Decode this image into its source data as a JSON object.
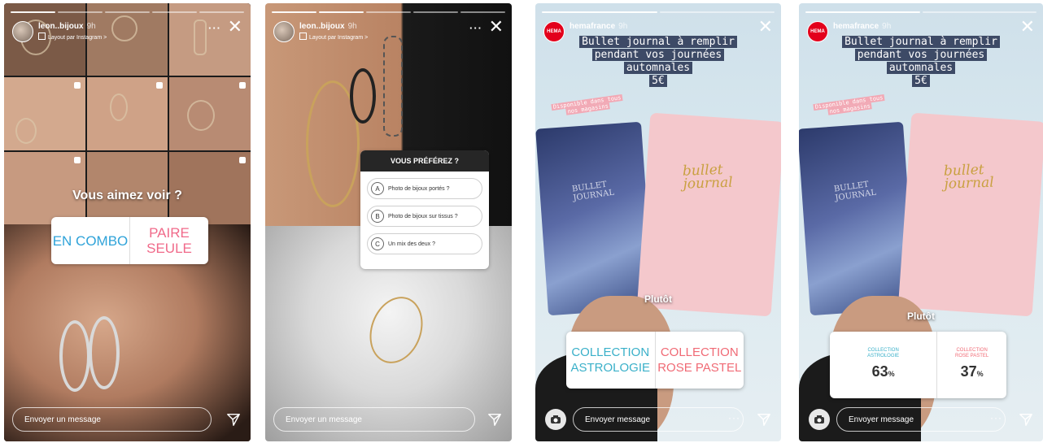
{
  "stories": {
    "leon": {
      "username": "leon..bijoux",
      "time": "9h",
      "subtitle": "Layout par Instagram >",
      "question": "Vous aimez voir ?",
      "poll": {
        "option_a": "EN COMBO",
        "option_b_line1": "PAIRE",
        "option_b_line2": "SEULE"
      },
      "message_placeholder": "Envoyer un message"
    },
    "leon_quiz": {
      "username": "leon..bijoux",
      "time": "9h",
      "subtitle": "Layout par Instagram >",
      "quiz": {
        "title": "VOUS PRÉFÉREZ ?",
        "options": [
          {
            "letter": "A",
            "text": "Photo de bijoux portés ?"
          },
          {
            "letter": "B",
            "text": "Photo de bijoux sur tissus ?"
          },
          {
            "letter": "C",
            "text": "Un mix des deux ?"
          }
        ]
      },
      "message_placeholder": "Envoyer un message"
    },
    "hema_poll": {
      "username": "hemafrance",
      "time": "9h",
      "avatar_text": "HEMA",
      "headline": [
        "Bullet journal à remplir",
        "pendant vos journées",
        "automnales",
        "5€"
      ],
      "sub_sticker": [
        "Disponible dans tous",
        "nos magasins"
      ],
      "book_blue_title": [
        "BULLET",
        "JOURNAL"
      ],
      "book_pink_title": [
        "bullet",
        "journal"
      ],
      "question": "Plutôt",
      "poll": {
        "option_a_line1": "COLLECTION",
        "option_a_line2": "ASTROLOGIE",
        "option_b_line1": "COLLECTION",
        "option_b_line2": "ROSE PASTEL"
      },
      "message_placeholder": "Envoyer message"
    },
    "hema_results": {
      "username": "hemafrance",
      "time": "9h",
      "avatar_text": "HEMA",
      "headline": [
        "Bullet journal à remplir",
        "pendant vos journées",
        "automnales",
        "5€"
      ],
      "sub_sticker": [
        "Disponible dans tous",
        "nos magasins"
      ],
      "book_blue_title": [
        "BULLET",
        "JOURNAL"
      ],
      "book_pink_title": [
        "bullet",
        "journal"
      ],
      "question": "Plutôt",
      "results": {
        "a_label_line1": "COLLECTION",
        "a_label_line2": "ASTROLOGIE",
        "a_percent": "63",
        "b_label_line1": "COLLECTION",
        "b_label_line2": "ROSE PASTEL",
        "b_percent": "37",
        "percent_sign": "%"
      },
      "message_placeholder": "Envoyer message"
    }
  },
  "icons": {
    "close": "close-icon",
    "more": "more-icon",
    "send": "send-icon",
    "camera": "camera-icon"
  },
  "colors": {
    "poll_blue": "#2fa3d9",
    "poll_pink": "#f06a8a",
    "hema_red": "#e3001b",
    "headline_bg": "#3d4a66"
  }
}
